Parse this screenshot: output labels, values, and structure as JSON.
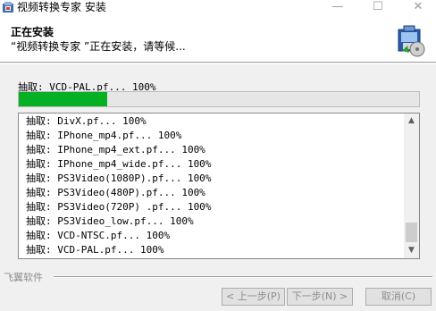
{
  "window": {
    "title": "视频转换专家  安装",
    "min_glyph": "—",
    "max_glyph": "☐",
    "close_glyph": "✕"
  },
  "header": {
    "title": "正在安装",
    "subtitle": "“视频转换专家 ”正在安装，请等候..."
  },
  "status": {
    "text": "抽取: VCD-PAL.pf... 100%"
  },
  "progress": {
    "percent": 22,
    "color": "#06b025"
  },
  "log": {
    "lines": [
      "抽取: DivX.pf... 100%",
      "抽取: IPhone_mp4.pf... 100%",
      "抽取: IPhone_mp4_ext.pf... 100%",
      "抽取: IPhone_mp4_wide.pf... 100%",
      "抽取: PS3Video(1080P).pf... 100%",
      "抽取: PS3Video(480P).pf... 100%",
      "抽取: PS3Video(720P) .pf... 100%",
      "抽取: PS3Video_low.pf... 100%",
      "抽取: VCD-NTSC.pf... 100%",
      "抽取: VCD-PAL.pf... 100%"
    ],
    "scroll_up_icon": "▲",
    "scroll_down_icon": "▼"
  },
  "footer": {
    "brand": "飞翼软件"
  },
  "buttons": {
    "back": "< 上一步(P)",
    "next": "下一步(N) >",
    "cancel": "取消(C)"
  }
}
